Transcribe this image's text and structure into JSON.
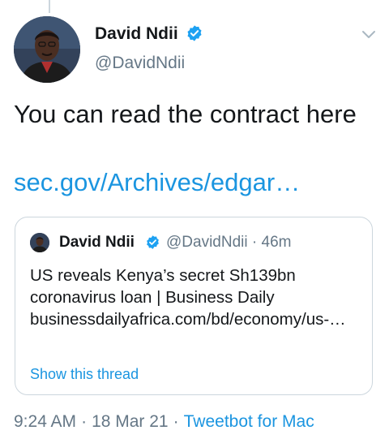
{
  "tweet": {
    "author_name": "David Ndii",
    "author_handle": "@DavidNdii",
    "text": "You can read the contract here",
    "link_text": "sec.gov/Archives/edgar…"
  },
  "quote": {
    "author_name": "David Ndii",
    "author_handle": "@DavidNdii",
    "dot": "·",
    "time_ago": "46m",
    "text": "US reveals Kenya’s secret Sh139bn coronavirus loan | Business Daily businessdailyafrica.com/bd/economy/us-…",
    "show_thread": "Show this thread"
  },
  "footer": {
    "time": "9:24 AM",
    "dot": "·",
    "date": "18 Mar 21",
    "source": "Tweetbot for Mac"
  },
  "icons": {
    "verified": "verified-badge-icon",
    "menu": "chevron-down-icon"
  },
  "colors": {
    "link": "#1b95e0",
    "secondary_text": "#657786",
    "verified": "#1da1f2",
    "border": "#ccd6dd"
  }
}
